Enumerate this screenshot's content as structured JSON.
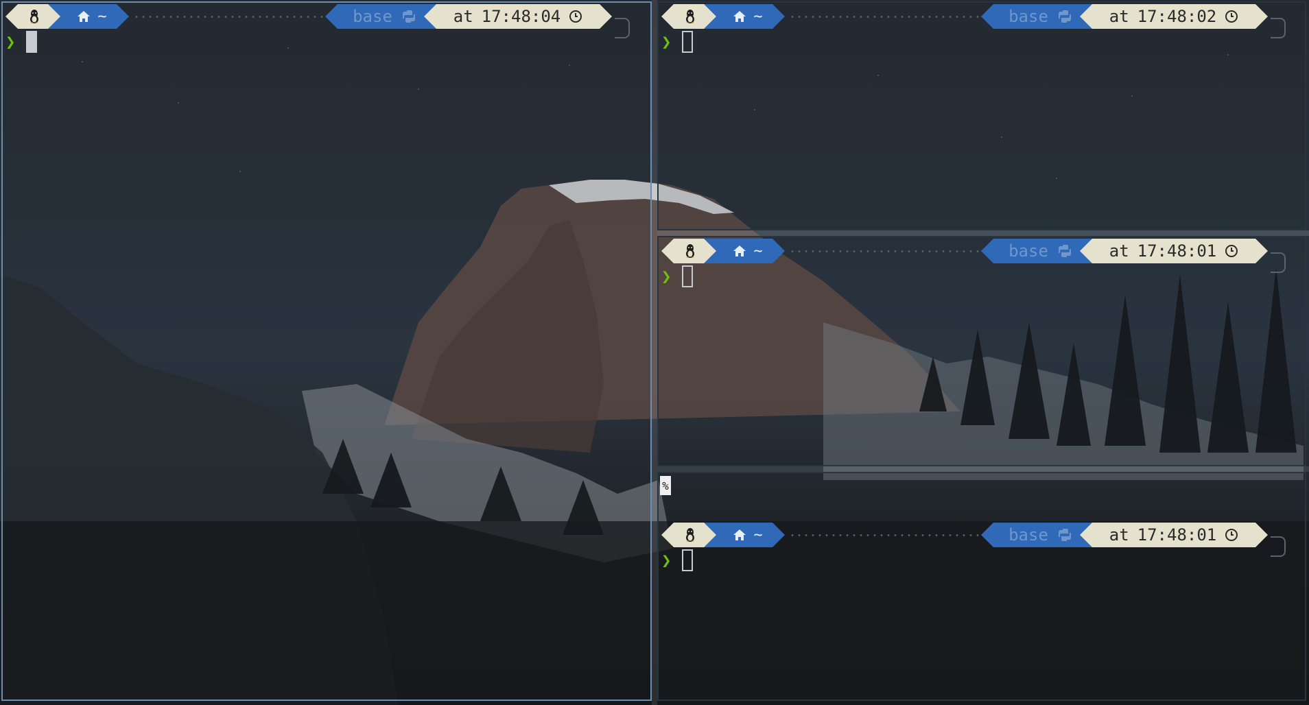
{
  "terminal": {
    "panes": [
      {
        "id": "pane-1",
        "focused": true,
        "os_icon": "linux-tux-icon",
        "dir_icon": "home-icon",
        "dir": "~",
        "env": "base",
        "env_icon": "python-icon",
        "time_prefix": "at",
        "time": "17:48:04",
        "time_icon": "clock-icon",
        "input_prompt": "❯",
        "cursor_style": "block"
      },
      {
        "id": "pane-2",
        "focused": false,
        "os_icon": "linux-tux-icon",
        "dir_icon": "home-icon",
        "dir": "~",
        "env": "base",
        "env_icon": "python-icon",
        "time_prefix": "at",
        "time": "17:48:02",
        "time_icon": "clock-icon",
        "input_prompt": "❯",
        "cursor_style": "hollow"
      },
      {
        "id": "pane-3",
        "focused": false,
        "os_icon": "linux-tux-icon",
        "dir_icon": "home-icon",
        "dir": "~",
        "env": "base",
        "env_icon": "python-icon",
        "time_prefix": "at",
        "time": "17:48:01",
        "time_icon": "clock-icon",
        "input_prompt": "❯",
        "cursor_style": "hollow"
      },
      {
        "id": "pane-4",
        "focused": false,
        "eol_mark": "%",
        "os_icon": "linux-tux-icon",
        "dir_icon": "home-icon",
        "dir": "~",
        "env": "base",
        "env_icon": "python-icon",
        "time_prefix": "at",
        "time": "17:48:01",
        "time_icon": "clock-icon",
        "input_prompt": "❯",
        "cursor_style": "hollow"
      }
    ]
  },
  "colors": {
    "prompt_light_segment": "#e4e1cc",
    "prompt_blue_segment": "#2f69b8",
    "prompt_chevron": "#6ec20e",
    "focused_border": "#6b8eb3"
  }
}
